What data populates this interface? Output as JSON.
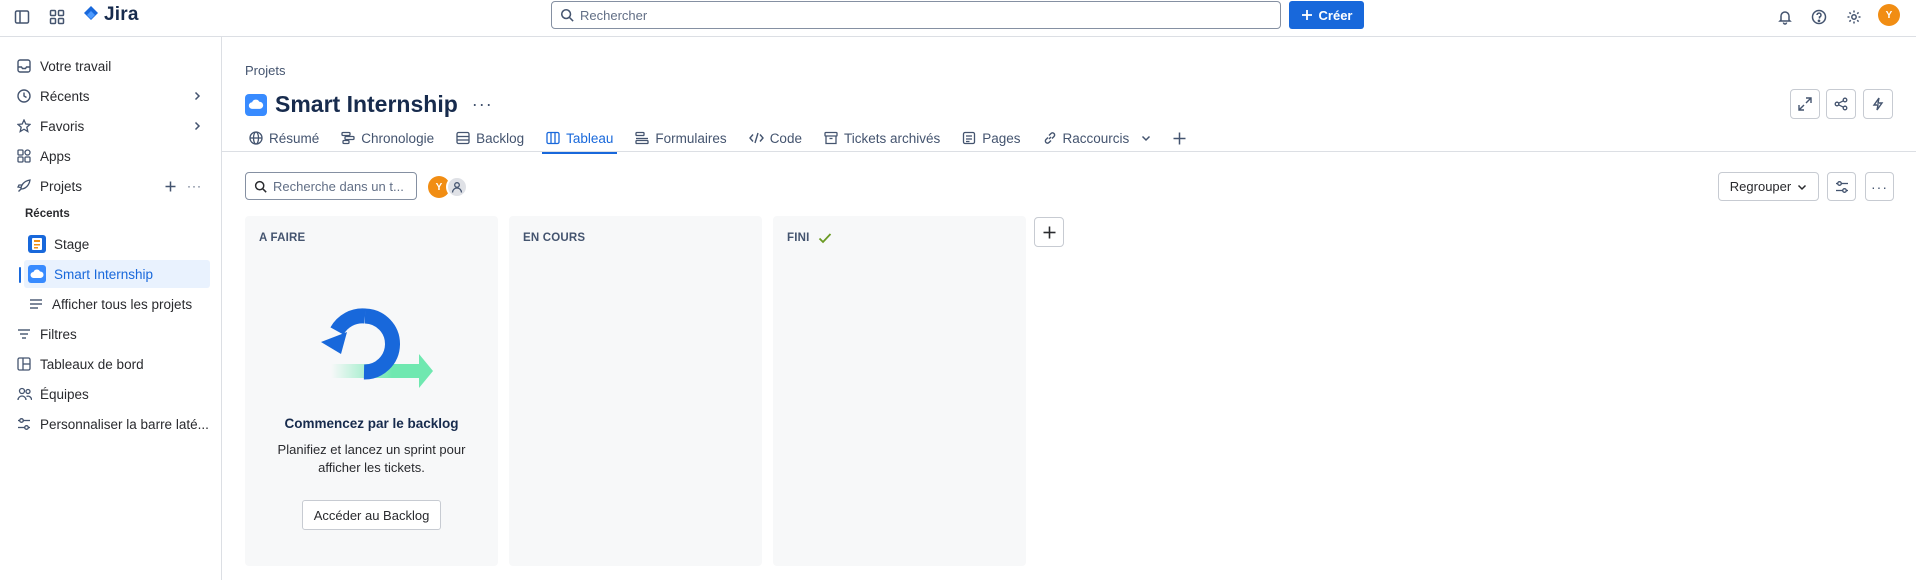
{
  "topbar": {
    "app_name": "Jira",
    "search_placeholder": "Rechercher",
    "create_label": "Créer",
    "user_initial": "Y"
  },
  "sidebar": {
    "items": [
      {
        "label": "Votre travail",
        "icon": "inbox-icon"
      },
      {
        "label": "Récents",
        "icon": "clock-icon"
      },
      {
        "label": "Favoris",
        "icon": "star-icon"
      },
      {
        "label": "Apps",
        "icon": "apps-icon"
      },
      {
        "label": "Projets",
        "icon": "rocket-icon"
      }
    ],
    "recent_section": "Récents",
    "projects": [
      {
        "label": "Stage",
        "active": false
      },
      {
        "label": "Smart Internship",
        "active": true
      }
    ],
    "all_projects": "Afficher tous les projets",
    "bottom_items": [
      {
        "label": "Filtres"
      },
      {
        "label": "Tableaux de bord"
      },
      {
        "label": "Équipes"
      },
      {
        "label": "Personnaliser la barre laté..."
      }
    ]
  },
  "main": {
    "breadcrumb": "Projets",
    "project_title": "Smart Internship",
    "tabs": [
      {
        "label": "Résumé",
        "icon": "globe-icon"
      },
      {
        "label": "Chronologie",
        "icon": "timeline-icon"
      },
      {
        "label": "Backlog",
        "icon": "backlog-icon"
      },
      {
        "label": "Tableau",
        "icon": "board-icon",
        "active": true
      },
      {
        "label": "Formulaires",
        "icon": "forms-icon"
      },
      {
        "label": "Code",
        "icon": "code-icon"
      },
      {
        "label": "Tickets archivés",
        "icon": "archive-icon"
      },
      {
        "label": "Pages",
        "icon": "pages-icon"
      },
      {
        "label": "Raccourcis",
        "icon": "link-icon"
      }
    ],
    "board_search_placeholder": "Recherche dans un t...",
    "avatar_initial": "Y",
    "group_label": "Regrouper",
    "columns": [
      {
        "title": "A FAIRE"
      },
      {
        "title": "EN COURS"
      },
      {
        "title": "FINI"
      }
    ],
    "empty_state": {
      "title": "Commencez par le backlog",
      "description": "Planifiez et lancez un sprint pour afficher les tickets.",
      "button": "Accéder au Backlog"
    }
  },
  "colors": {
    "accent": "#1868db",
    "avatar": "#f18d13",
    "done_check": "#6a9a23"
  }
}
